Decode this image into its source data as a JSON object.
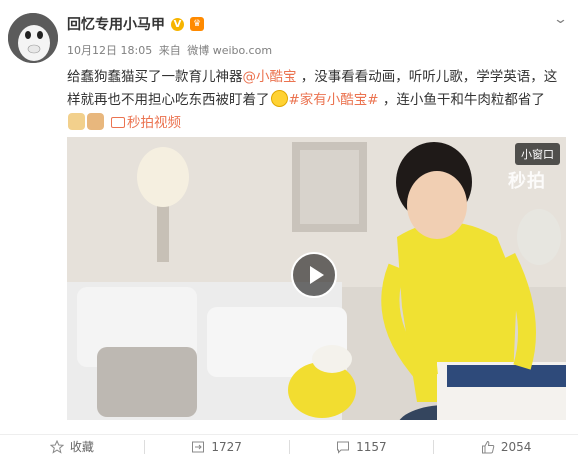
{
  "post": {
    "author": "回忆专用小马甲",
    "date": "10月12日 18:05",
    "source_prefix": "来自",
    "source": "微博 weibo.com",
    "text_part1": "给蠢狗蠢猫买了一款育儿神器",
    "mention": "@小酷宝",
    "text_part2": " ，没事看看动画，听听儿歌，学学英语，这样就再也不用担心吃东西被盯着了",
    "hashtag": "#家有小酷宝#",
    "text_part3": " ，连小鱼干和牛肉粒都省了",
    "video_link": "秒拍视频"
  },
  "video": {
    "mini_window_label": "小窗口",
    "watermark": "秒拍"
  },
  "actions": {
    "favorite_label": "收藏",
    "repost_count": "1727",
    "comment_count": "1157",
    "like_count": "2054"
  },
  "colors": {
    "link": "#eb7350",
    "vip_badge": "#f6b400",
    "shirt": "#f2e23a"
  },
  "icons": [
    "chevron-down-icon",
    "verified-icon",
    "member-icon",
    "star-icon",
    "repost-icon",
    "comment-icon",
    "like-icon",
    "play-icon",
    "video-icon"
  ]
}
